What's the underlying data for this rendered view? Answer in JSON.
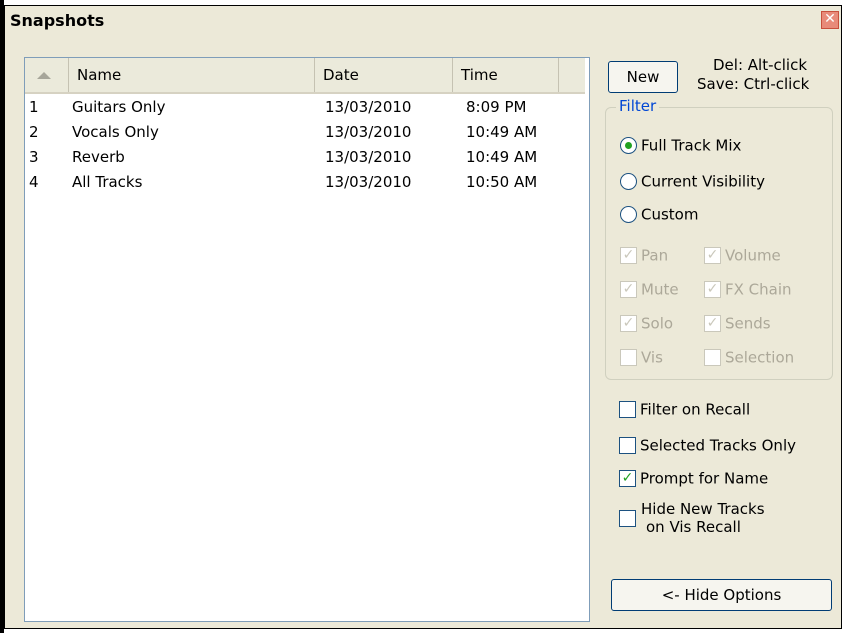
{
  "window": {
    "title": "Snapshots",
    "close_glyph": "✕"
  },
  "list": {
    "columns": [
      "Name",
      "Date",
      "Time"
    ],
    "rows": [
      {
        "num": "1",
        "name": "Guitars Only",
        "date": "13/03/2010",
        "time": "8:09 PM"
      },
      {
        "num": "2",
        "name": "Vocals Only",
        "date": "13/03/2010",
        "time": "10:49 AM"
      },
      {
        "num": "3",
        "name": "Reverb",
        "date": "13/03/2010",
        "time": "10:49 AM"
      },
      {
        "num": "4",
        "name": "All Tracks",
        "date": "13/03/2010",
        "time": "10:50 AM"
      }
    ]
  },
  "new_button": "New",
  "hint": {
    "del": "Del: Alt-click",
    "save": "Save: Ctrl-click"
  },
  "filter": {
    "label": "Filter",
    "radios": [
      {
        "label": "Full Track Mix",
        "selected": true
      },
      {
        "label": "Current Visibility",
        "selected": false
      },
      {
        "label": "Custom",
        "selected": false
      }
    ],
    "checks": [
      {
        "label": "Pan",
        "checked": true
      },
      {
        "label": "Volume",
        "checked": true
      },
      {
        "label": "Mute",
        "checked": true
      },
      {
        "label": "FX Chain",
        "checked": true
      },
      {
        "label": "Solo",
        "checked": true
      },
      {
        "label": "Sends",
        "checked": true
      },
      {
        "label": "Vis",
        "checked": false
      },
      {
        "label": "Selection",
        "checked": false
      }
    ]
  },
  "options": [
    {
      "label": "Filter on Recall",
      "checked": false
    },
    {
      "label": "Selected Tracks Only",
      "checked": false
    },
    {
      "label": "Prompt for Name",
      "checked": true
    },
    {
      "label": "Hide New Tracks",
      "label2": "on Vis Recall",
      "checked": false
    }
  ],
  "hide_options_button": "<- Hide Options",
  "colors": {
    "accent": "#21a121",
    "group_label": "#0046d5",
    "window_bg": "#ece9d8"
  }
}
